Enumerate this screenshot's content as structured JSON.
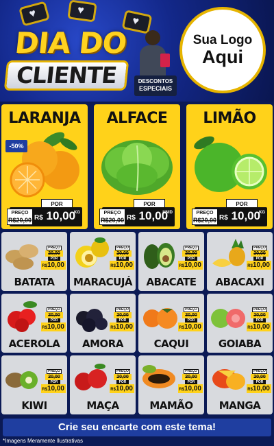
{
  "header": {
    "title_line1": "DIA DO",
    "title_line2": "CLIENTE",
    "promo_line1": "DESCONTOS",
    "promo_line2": "ESPECIAIS",
    "logo_line1": "Sua Logo",
    "logo_line2": "Aqui"
  },
  "featured": [
    {
      "name": "LARANJA",
      "badge": "-50%",
      "preco_label": "PREÇO",
      "old": "20,00",
      "por": "POR",
      "currency": "R$",
      "value": "10,00",
      "unit": "KG",
      "icon": "orange-icon"
    },
    {
      "name": "ALFACE",
      "badge": "",
      "preco_label": "PREÇO",
      "old": "20,00",
      "por": "POR",
      "currency": "R$",
      "value": "10,00",
      "unit": "UNID",
      "icon": "lettuce-icon"
    },
    {
      "name": "LIMÃO",
      "badge": "",
      "preco_label": "PREÇO",
      "old": "20,00",
      "por": "POR",
      "currency": "R$",
      "value": "10,00",
      "unit": "KG",
      "icon": "lime-icon"
    }
  ],
  "grid": [
    {
      "name": "BATATA",
      "icon": "potato-icon",
      "preco_label": "PREÇO",
      "old": "20,00",
      "por": "POR",
      "currency": "R$",
      "value": "10,00"
    },
    {
      "name": "MARACUJÁ",
      "icon": "passionfruit-icon",
      "preco_label": "PREÇO",
      "old": "20,00",
      "por": "POR",
      "currency": "R$",
      "value": "10,00"
    },
    {
      "name": "ABACATE",
      "icon": "avocado-icon",
      "preco_label": "PREÇO",
      "old": "20,00",
      "por": "POR",
      "currency": "R$",
      "value": "10,00"
    },
    {
      "name": "ABACAXI",
      "icon": "pineapple-icon",
      "preco_label": "PREÇO",
      "old": "20,00",
      "por": "POR",
      "currency": "R$",
      "value": "10,00"
    },
    {
      "name": "ACEROLA",
      "icon": "acerola-icon",
      "preco_label": "PREÇO",
      "old": "20,00",
      "por": "POR",
      "currency": "R$",
      "value": "10,00"
    },
    {
      "name": "AMORA",
      "icon": "blackberry-icon",
      "preco_label": "PREÇO",
      "old": "20,00",
      "por": "POR",
      "currency": "R$",
      "value": "10,00"
    },
    {
      "name": "CAQUI",
      "icon": "persimmon-icon",
      "preco_label": "PREÇO",
      "old": "20,00",
      "por": "POR",
      "currency": "R$",
      "value": "10,00"
    },
    {
      "name": "GOIABA",
      "icon": "guava-icon",
      "preco_label": "PREÇO",
      "old": "20,00",
      "por": "POR",
      "currency": "R$",
      "value": "10,00"
    },
    {
      "name": "KIWI",
      "icon": "kiwi-icon",
      "preco_label": "PREÇO",
      "old": "20,00",
      "por": "POR",
      "currency": "R$",
      "value": "10,00"
    },
    {
      "name": "MAÇA",
      "icon": "apple-icon",
      "preco_label": "PREÇO",
      "old": "20,00",
      "por": "POR",
      "currency": "R$",
      "value": "10,00"
    },
    {
      "name": "MAMÃO",
      "icon": "papaya-icon",
      "preco_label": "PREÇO",
      "old": "20,00",
      "por": "POR",
      "currency": "R$",
      "value": "10,00"
    },
    {
      "name": "MANGA",
      "icon": "mango-icon",
      "preco_label": "PREÇO",
      "old": "20,00",
      "por": "POR",
      "currency": "R$",
      "value": "10,00"
    }
  ],
  "footer": {
    "cta": "Crie seu encarte com este tema!",
    "disclaimer": "*Imagens Meramente Ilustrativas"
  },
  "colors": {
    "accent": "#ffd21a",
    "brand_blue": "#1f3ea0",
    "dark": "#111111"
  }
}
